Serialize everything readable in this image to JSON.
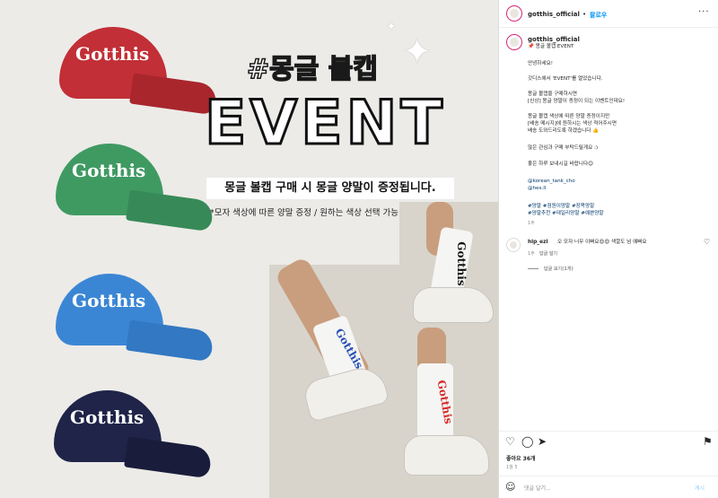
{
  "image": {
    "cap_logo": "Gotthis",
    "cap_colors": [
      "#c22f36",
      "#3f9a62",
      "#3b86d4",
      "#1f2448"
    ],
    "hash_title": "#몽글 볼캡",
    "event_title": "EVENT",
    "banner": "몽글 볼캡 구매 시 몽글 양말이 증정됩니다.",
    "note": "*모자 색상에 따른 양말 증정 / 원하는 색상 선택 가능",
    "sock_logo": "Gotthis"
  },
  "header": {
    "username": "gotthis_official",
    "separator": "•",
    "follow": "팔로우",
    "more": "···"
  },
  "caption": {
    "username": "gotthis_official",
    "subtitle": "📌 몽글 볼캡 EVENT",
    "lines": [
      "안녕하세요!",
      "갓디스에서 'EVENT'를 열었습니다.",
      "몽글 볼캡을 구매하시면",
      "[신상] 몽글 양말이 증정이 되는 이벤트인데요!",
      "몽글 볼캡 색상에 따른 양말 증정이지만",
      "[배송 메시지]에 원하시는 색상 적어주시면",
      "배송 도와드리도록 하겠습니다 👍",
      "많은 관심과 구매 부탁드릴게요 :)",
      "좋은 하루 보내시길 바랍니다😊"
    ],
    "mentions": [
      "@korean_tank_cho",
      "@hes.ll"
    ],
    "hashtags_line1": "#양말 #점원이양말 #장목양말",
    "hashtags_line2": "#양말추천 #데일리양말 #예쁜양말",
    "time": "1주"
  },
  "comment": {
    "username": "hip_ezi",
    "text": "오 모자 너무 이뻐요😍😍 색깔도 넘 예뻐요",
    "time": "1주",
    "reply": "답글 달기",
    "view_replies": "답글 보기(1개)"
  },
  "actions": {
    "likes": "좋아요 36개",
    "time": "1월 5",
    "placeholder": "댓글 달기...",
    "post": "게시"
  },
  "icons": [
    "heart-icon",
    "comment-icon",
    "share-icon",
    "bookmark-icon",
    "emoji-icon",
    "more-icon"
  ]
}
